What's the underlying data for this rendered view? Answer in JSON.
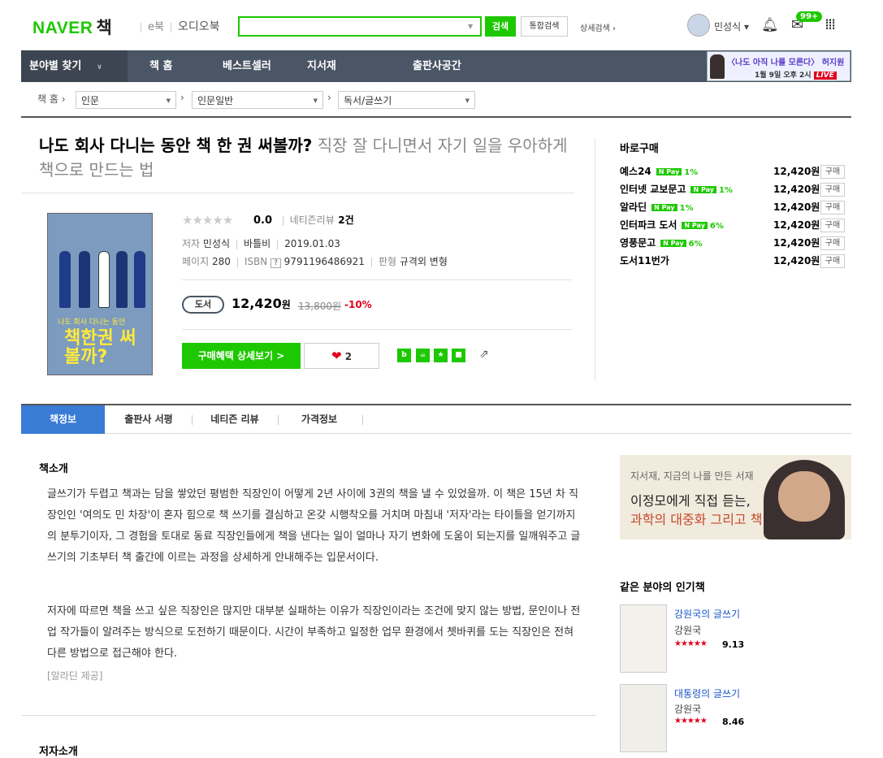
{
  "header": {
    "logo": "NAVER",
    "logo_book": "책",
    "ebook": "e북",
    "audiobook": "오디오북",
    "search_placeholder": "",
    "search_button": "검색",
    "total_search": "통합검색",
    "advanced_search": "상세검색",
    "user_name": "민성식",
    "mail_badge": "99+",
    "brand_color": "#1ec800"
  },
  "nav": {
    "category": "분야별 찾기",
    "items": [
      "책 홈",
      "베스트셀러",
      "지서재",
      "출판사공간"
    ],
    "ad_line1": "〈나도 아직 나를 모른다〉 허지원",
    "ad_line2": "1월 9일 오후 2시",
    "ad_live": "LIVE"
  },
  "breadcrumb": {
    "home": "책 홈",
    "level1": "인문",
    "level2": "인문일반",
    "level3": "독서/글쓰기"
  },
  "book": {
    "title": "나도 회사 다니는 동안 책 한 권 써볼까?",
    "subtitle": "직장 잘 다니면서 자기 일을 우아하게 책으로 만드는 법",
    "stars": "★★★★★",
    "rating": "0.0",
    "review_label": "네티즌리뷰",
    "review_count": "2건",
    "author_label": "저자",
    "author": "민성식",
    "publisher": "바틀비",
    "date": "2019.01.03",
    "pages_label": "페이지",
    "pages": "280",
    "isbn_label": "ISBN",
    "isbn_help": "?",
    "isbn": "9791196486921",
    "format_label": "판형",
    "format": "규격외 변형",
    "type_badge": "도서",
    "price": "12,420",
    "price_unit": "원",
    "original_price": "13,800원",
    "discount": "-10%",
    "benefit_button": "구매혜택 상세보기 >",
    "like_count": "2",
    "cover_small": "나도 회사 다니는 동안",
    "cover_big": "책한권 써볼까?"
  },
  "purchase": {
    "title": "바로구매",
    "stores": [
      {
        "name": "예스24",
        "npay": "N Pay",
        "pct": "1%",
        "price": "12,420원",
        "buy": "구매"
      },
      {
        "name": "인터넷 교보문고",
        "npay": "N Pay",
        "pct": "1%",
        "price": "12,420원",
        "buy": "구매"
      },
      {
        "name": "알라딘",
        "npay": "N Pay",
        "pct": "1%",
        "price": "12,420원",
        "buy": "구매"
      },
      {
        "name": "인터파크 도서",
        "npay": "N Pay",
        "pct": "6%",
        "price": "12,420원",
        "buy": "구매"
      },
      {
        "name": "영풍문고",
        "npay": "N Pay",
        "pct": "6%",
        "price": "12,420원",
        "buy": "구매"
      },
      {
        "name": "도서11번가",
        "npay": "",
        "pct": "",
        "price": "12,420원",
        "buy": "구매"
      }
    ]
  },
  "tabs": [
    "책정보",
    "출판사 서평",
    "네티즌 리뷰",
    "가격정보"
  ],
  "intro": {
    "heading": "책소개",
    "p1": "글쓰기가 두렵고 책과는 담을 쌓았던 평범한 직장인이 어떻게 2년 사이에 3권의 책을 낼 수 있었을까. 이 책은 15년 차 직장인인 '여의도 민 차장'이 혼자 힘으로 책 쓰기를 결심하고 온갖 시행착오를 거치며 마침내 '저자'라는 타이틀을 얻기까지의 분투기이자, 그 경험을 토대로 동료 직장인들에게 책을 낸다는 일이 얼마나 자기 변화에 도움이 되는지를 일깨워주고 글쓰기의 기초부터 책 출간에 이르는 과정을 상세하게 안내해주는 입문서이다.",
    "p2": "저자에 따르면 책을 쓰고 싶은 직장인은 많지만 대부분 실패하는 이유가 직장인이라는 조건에 맞지 않는 방법, 문인이나 전업 작가들이 알려주는 방식으로 도전하기 때문이다. 시간이 부족하고 일정한 업무 환경에서 쳇바퀴를 도는 직장인은 전혀 다른 방법으로 접근해야 한다.",
    "source": "[알라딘 제공]",
    "author_heading": "저자소개"
  },
  "banner": {
    "line1": "지서재, 지금의 나를 만든 서재",
    "line2": "이정모에게 직접 듣는,",
    "line3": "과학의 대중화 그리고 책"
  },
  "popular": {
    "heading": "같은 분야의 인기책",
    "books": [
      {
        "title": "강원국의 글쓰기",
        "author": "강원국",
        "stars": "★★★★★",
        "score": "9.13",
        "score_value": 9.13
      },
      {
        "title": "대통령의 글쓰기",
        "author": "강원국",
        "stars": "★★★★★",
        "score": "8.46",
        "score_value": 8.46
      }
    ]
  }
}
